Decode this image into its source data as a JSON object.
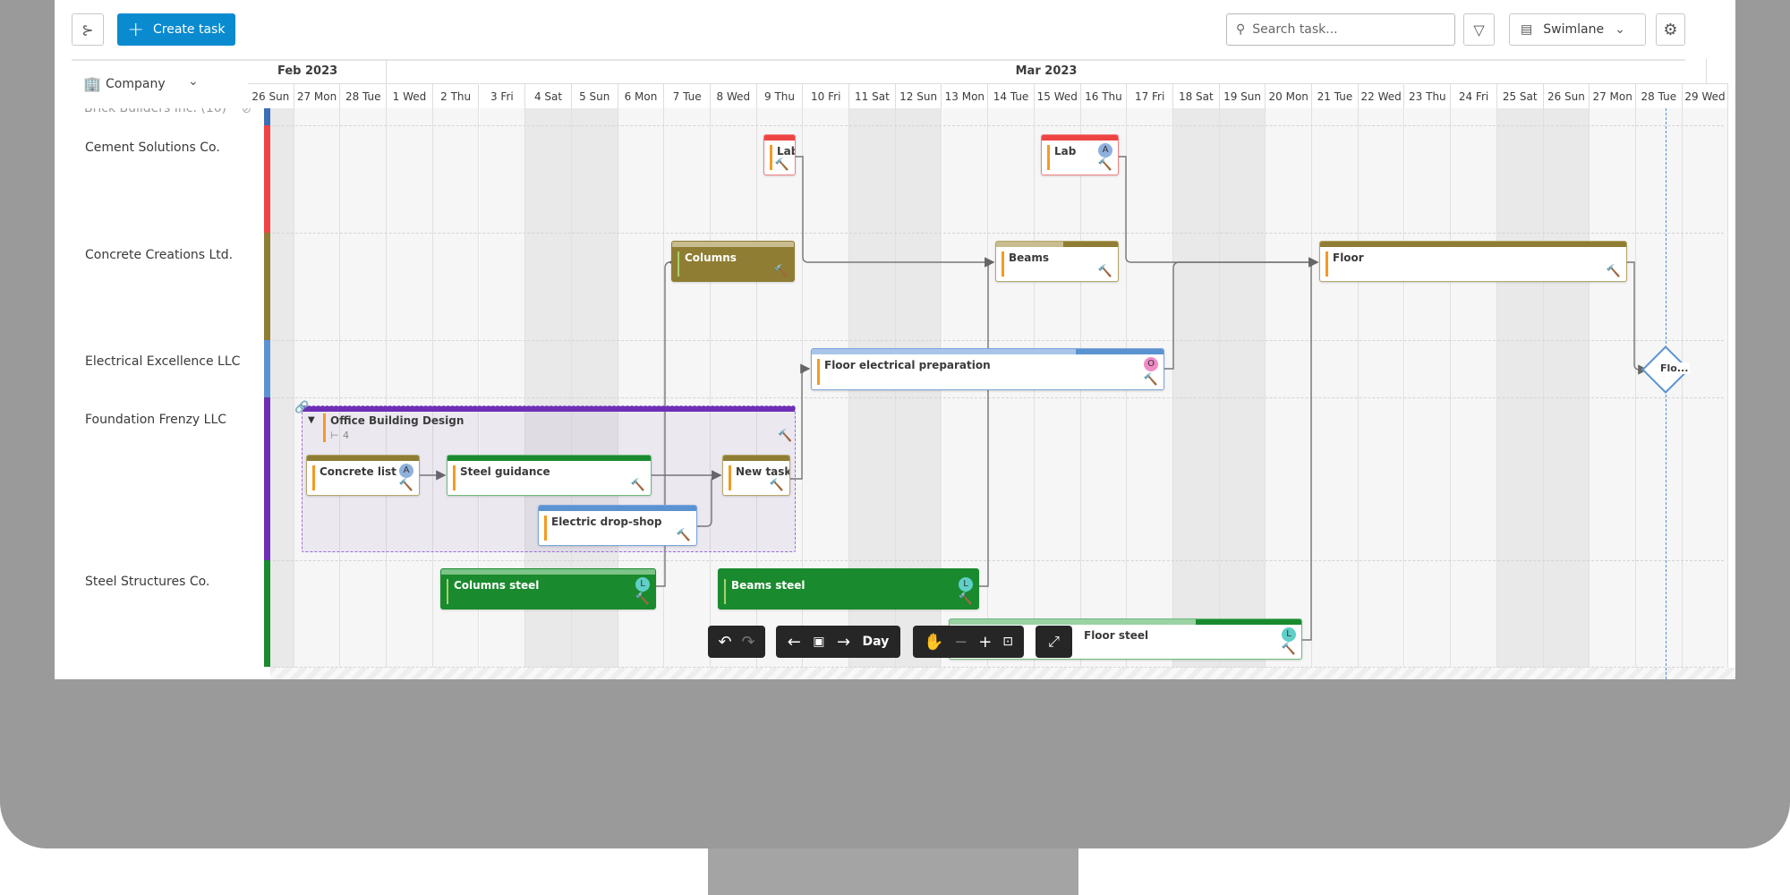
{
  "toolbar": {
    "create_label": "Create task",
    "search_placeholder": "Search task...",
    "view_label": "Swimlane",
    "icons": [
      "hierarchy-icon",
      "plus-icon",
      "search-icon",
      "filter-icon",
      "swimlane-icon",
      "chevron-down-icon",
      "gear-icon"
    ]
  },
  "left_panel": {
    "group_by": "Company",
    "partial_lane": "Brick Builders Inc. (10)",
    "lanes": [
      {
        "name": "Cement Solutions Co.",
        "color": "#ef4444"
      },
      {
        "name": "Concrete Creations Ltd.",
        "color": "#8f7d34"
      },
      {
        "name": "Electrical Excellence LLC",
        "color": "#5b93d1"
      },
      {
        "name": "Foundation Frenzy LLC",
        "color": "#6d2fb5"
      },
      {
        "name": "Steel Structures Co.",
        "color": "#1a8a2e"
      }
    ]
  },
  "timeline": {
    "months": [
      "Feb 2023",
      "Mar 2023"
    ],
    "days": [
      "26 Sun",
      "27 Mon",
      "28 Tue",
      "1 Wed",
      "2 Thu",
      "3 Fri",
      "4 Sat",
      "5 Sun",
      "6 Mon",
      "7 Tue",
      "8 Wed",
      "9 Thu",
      "10 Fri",
      "11 Sat",
      "12 Sun",
      "13 Mon",
      "14 Tue",
      "15 Wed",
      "16 Thu",
      "17 Fri",
      "18 Sat",
      "19 Sun",
      "20 Mon",
      "21 Tue",
      "22 Wed",
      "23 Thu",
      "24 Fri",
      "25 Sat",
      "26 Sun",
      "27 Mon",
      "28 Tue",
      "29 Wed"
    ],
    "today": "28 Tue"
  },
  "tasks": {
    "lab1": {
      "title": "Lab"
    },
    "lab2": {
      "title": "Lab",
      "avatar": "A"
    },
    "columns": {
      "title": "Columns",
      "progress": 0.9
    },
    "beams": {
      "title": "Beams",
      "progress": 0.55
    },
    "floor": {
      "title": "Floor"
    },
    "floor_elec": {
      "title": "Floor electrical preparation",
      "avatar": "O",
      "progress": 0.75
    },
    "milestone": {
      "title": "Flo..."
    },
    "group": {
      "title": "Office Building Design",
      "subtask_count": "4"
    },
    "concrete_list": {
      "title": "Concrete list",
      "avatar": "A"
    },
    "steel_guidance": {
      "title": "Steel guidance"
    },
    "new_task": {
      "title": "New task"
    },
    "electric_drop": {
      "title": "Electric drop-shop"
    },
    "columns_steel": {
      "title": "Columns steel",
      "avatar": "L",
      "progress": 1.0
    },
    "beams_steel": {
      "title": "Beams steel",
      "avatar": "L"
    },
    "floor_steel": {
      "title": "Floor steel",
      "avatar": "L",
      "progress": 0.7
    }
  },
  "controls": {
    "scale_label": "Day"
  },
  "colors": {
    "accent": "#0a8bd0",
    "task_accent": "#f59a23",
    "today_line": "#4a8fe0"
  }
}
